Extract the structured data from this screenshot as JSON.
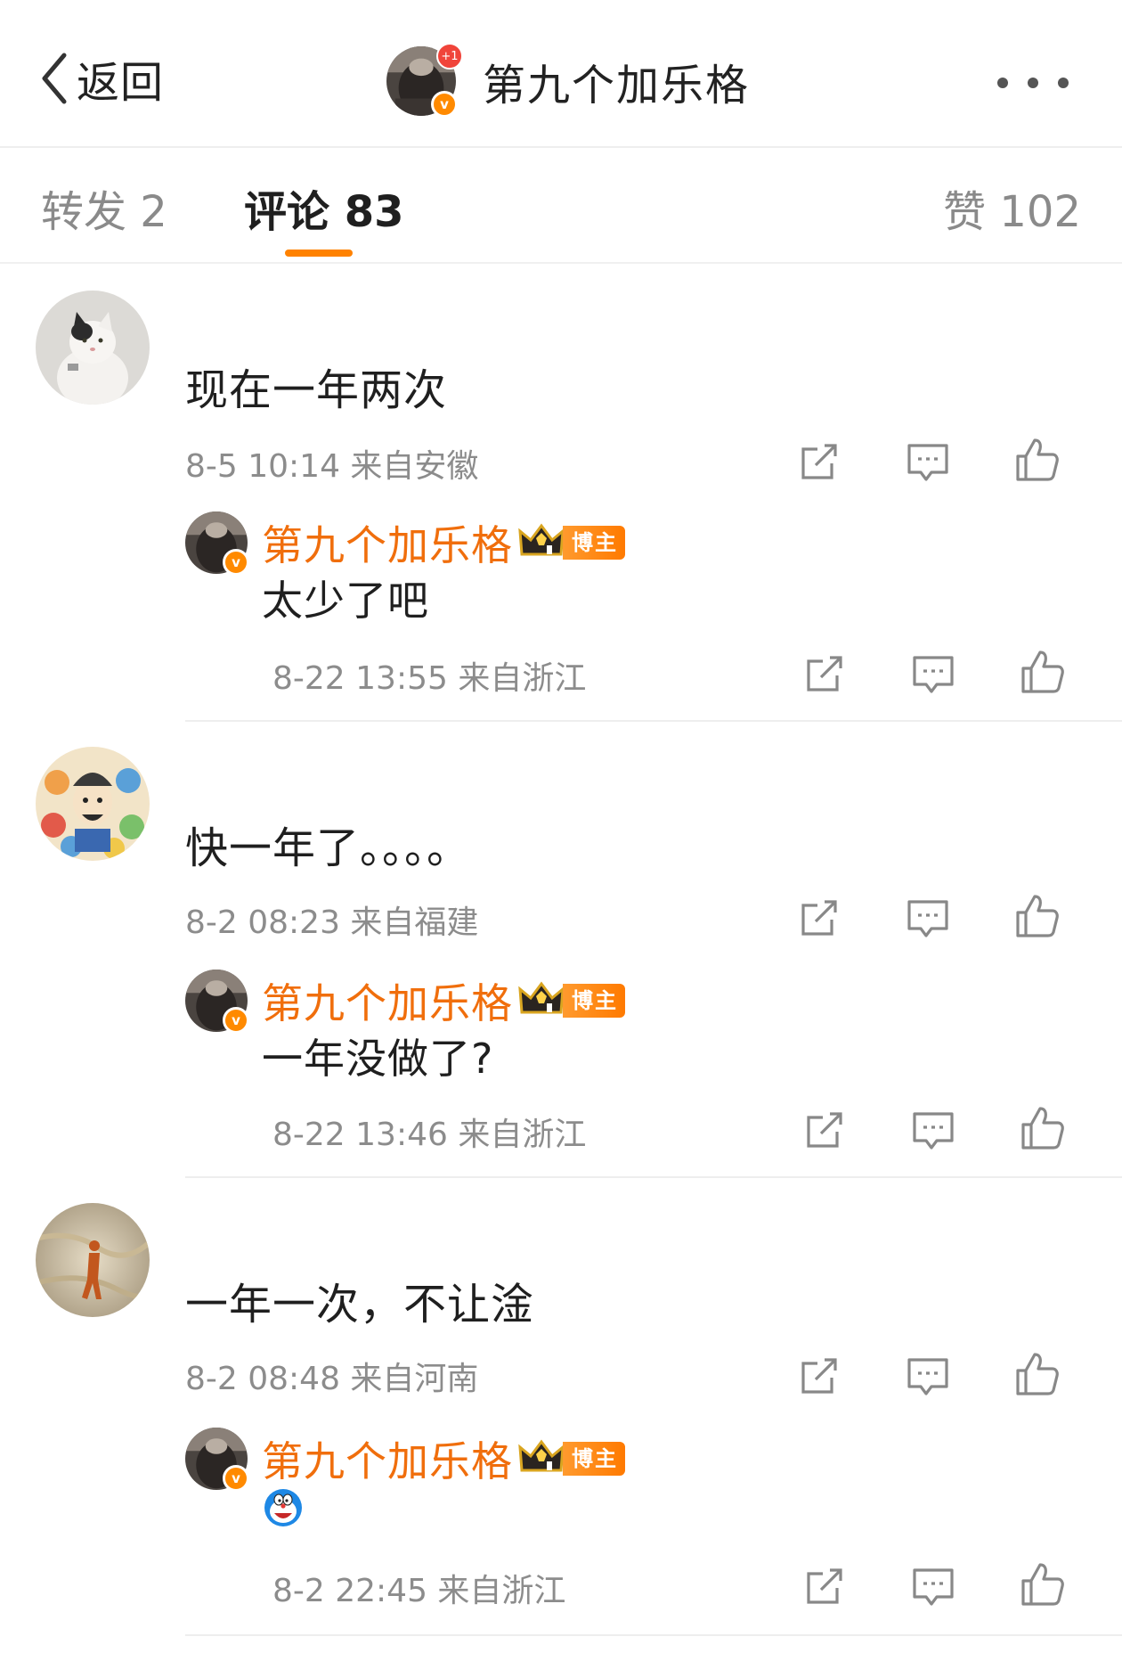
{
  "header": {
    "back_label": "返回",
    "title": "第九个加乐格",
    "notification_badge": "+1"
  },
  "tabs": {
    "repost": "转发 2",
    "comment": "评论 83",
    "like": "赞 102"
  },
  "comments": [
    {
      "text": "现在一年两次",
      "meta": "8-5 10:14 来自安徽",
      "reply": {
        "author": "第九个加乐格",
        "badge": "博主",
        "text": "太少了吧",
        "meta": "8-22 13:55 来自浙江"
      }
    },
    {
      "text": "快一年了。。。。",
      "meta": "8-2 08:23 来自福建",
      "reply": {
        "author": "第九个加乐格",
        "badge": "博主",
        "text": "一年没做了?",
        "meta": "8-22 13:46 来自浙江"
      }
    },
    {
      "text": "一年一次，不让淦",
      "meta": "8-2 08:48 来自河南",
      "reply": {
        "author": "第九个加乐格",
        "badge": "博主",
        "text": "",
        "emoji": "doraemon-emoji",
        "meta": "8-2 22:45 来自浙江"
      }
    }
  ],
  "icons": {
    "back": "chevron-left-icon",
    "more": "more-dots-icon",
    "share": "share-icon",
    "comment": "comment-icon",
    "like": "thumbs-up-icon",
    "verified": "verified-v-icon",
    "crown": "crown-icon"
  },
  "colors": {
    "accent": "#ff8200",
    "author_name": "#f06e0c",
    "meta_text": "#8c8c8c",
    "badge": "#ff7a00",
    "notification": "#f0443a"
  }
}
